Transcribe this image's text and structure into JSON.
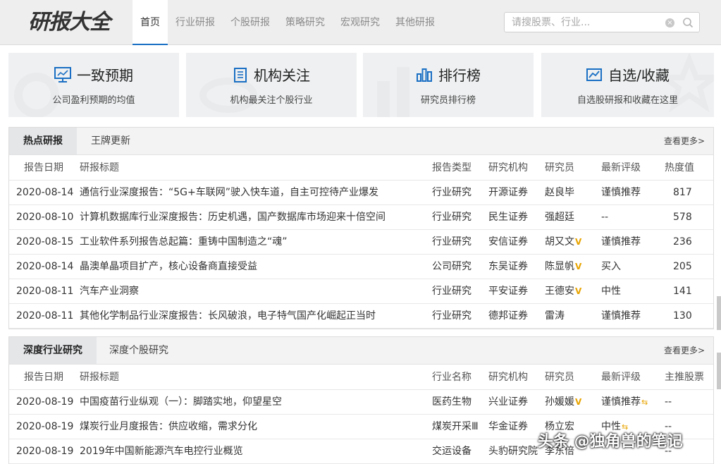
{
  "header": {
    "logo_text_a": "研报",
    "logo_text_b": "大全",
    "nav": [
      "首页",
      "行业研报",
      "个股研报",
      "策略研究",
      "宏观研究",
      "其他研报"
    ],
    "active_nav": 0,
    "search_placeholder": "请搜股票、行业...",
    "clear_icon_glyph": "×"
  },
  "cards": [
    {
      "title": "一致预期",
      "desc": "公司盈利预期的均值",
      "icon": "monitor-chart-icon"
    },
    {
      "title": "机构关注",
      "desc": "机构最关注个股行业",
      "icon": "building-icon"
    },
    {
      "title": "排行榜",
      "desc": "研究员排行榜",
      "icon": "bar-chart-icon"
    },
    {
      "title": "自选/收藏",
      "desc": "自选股研报和收藏在这里",
      "icon": "line-chart-icon"
    }
  ],
  "hot": {
    "tabs": [
      "热点研报",
      "王牌更新"
    ],
    "more": "查看更多>",
    "columns": [
      "报告日期",
      "研报标题",
      "报告类型",
      "研究机构",
      "研究员",
      "最新评级",
      "热度值"
    ],
    "rows": [
      {
        "date": "2020-08-14",
        "title": "通信行业深度报告：“5G+车联网”驶入快车道，自主可控待产业爆发",
        "type": "行业研究",
        "org": "开源证券",
        "analyst": "赵良毕",
        "v": "",
        "rating": "谨慎推荐",
        "heat": "817"
      },
      {
        "date": "2020-08-10",
        "title": "计算机数据库行业深度报告：历史机遇，国产数据库市场迎来十倍空间",
        "type": "行业研究",
        "org": "民生证券",
        "analyst": "强超廷",
        "v": "",
        "rating": "--",
        "heat": "578"
      },
      {
        "date": "2020-08-15",
        "title": "工业软件系列报告总起篇：重铸中国制造之“魂”",
        "type": "行业研究",
        "org": "安信证券",
        "analyst": "胡又文",
        "v": "V",
        "rating": "谨慎推荐",
        "heat": "236"
      },
      {
        "date": "2020-08-14",
        "title": "晶澳单晶项目扩产，核心设备商直接受益",
        "type": "公司研究",
        "org": "东吴证券",
        "analyst": "陈显帆",
        "v": "V",
        "rating": "买入",
        "heat": "205"
      },
      {
        "date": "2020-08-11",
        "title": "汽车产业洞察",
        "type": "行业研究",
        "org": "平安证券",
        "analyst": "王德安",
        "v": "V",
        "rating": "中性",
        "heat": "141"
      },
      {
        "date": "2020-08-11",
        "title": "其他化学制品行业深度报告：长风破浪，电子特气国产化崛起正当时",
        "type": "行业研究",
        "org": "德邦证券",
        "analyst": "雷涛",
        "v": "",
        "rating": "谨慎推荐",
        "heat": "130"
      }
    ]
  },
  "deep": {
    "tabs": [
      "深度行业研究",
      "深度个股研究"
    ],
    "more": "查看更多>",
    "columns": [
      "报告日期",
      "研报标题",
      "行业名称",
      "研究机构",
      "研究员",
      "最新评级",
      "主推股票"
    ],
    "rows": [
      {
        "date": "2020-08-19",
        "title": "中国疫苗行业纵观（一）：脚踏实地，仰望星空",
        "type": "医药生物",
        "org": "兴业证券",
        "analyst": "孙媛媛",
        "v": "V",
        "rating": "谨慎推荐",
        "arrow": "⇆",
        "heat": "--"
      },
      {
        "date": "2020-08-19",
        "title": "煤炭行业月度报告：供应收缩，需求分化",
        "type": "煤炭开采Ⅲ",
        "org": "华金证券",
        "analyst": "杨立宏",
        "v": "",
        "rating": "中性",
        "arrow": "⇆",
        "heat": "--"
      },
      {
        "date": "2020-08-19",
        "title": "2019年中国新能源汽车电控行业概览",
        "type": "交运设备",
        "org": "头豹研究院",
        "analyst": "李东倍",
        "v": "",
        "rating": "",
        "arrow": "",
        "heat": "--"
      }
    ]
  },
  "watermark_text": "头条 @独角兽的笔记",
  "colors": {
    "accent": "#1a6fc4",
    "v_badge": "#e8a400"
  }
}
